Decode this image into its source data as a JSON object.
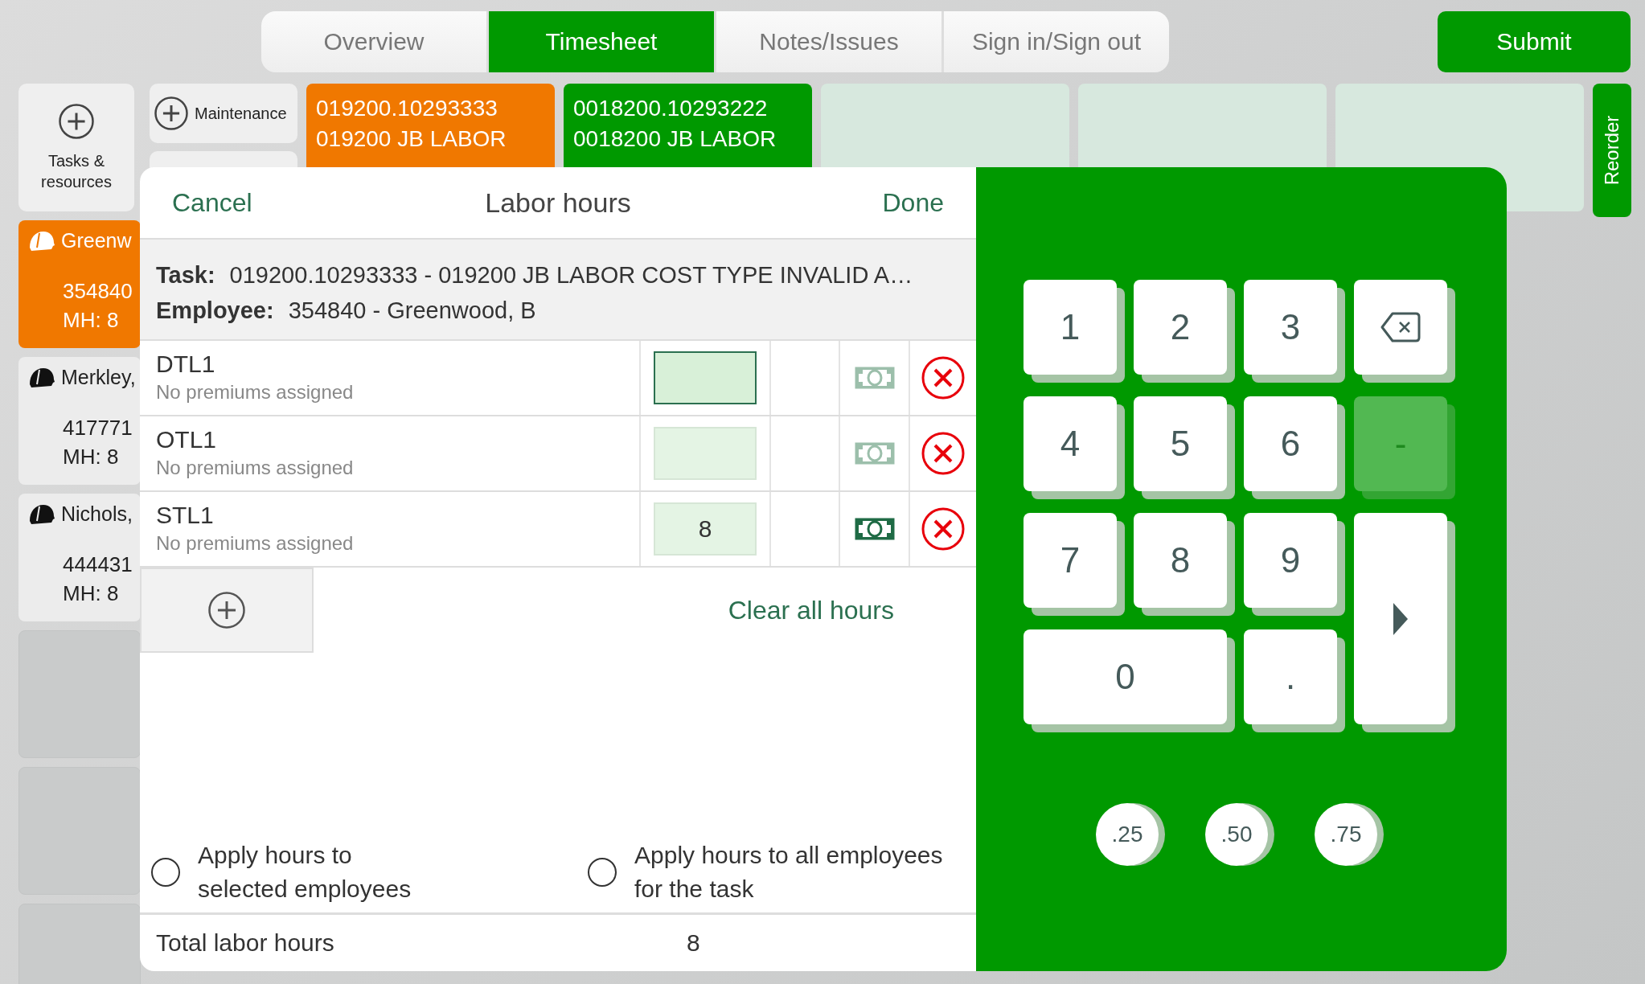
{
  "tabs": [
    {
      "label": "Overview",
      "selected": false
    },
    {
      "label": "Timesheet",
      "selected": true
    },
    {
      "label": "Notes/Issues",
      "selected": false
    },
    {
      "label": "Sign in/Sign out",
      "selected": false
    }
  ],
  "submit_button": "Submit",
  "add_tiles": [
    {
      "kind": "large",
      "label": "Tasks & resources"
    },
    {
      "kind": "inline",
      "label": "Maintenance"
    }
  ],
  "task_cards": [
    {
      "kind": "task",
      "color": "#f07800",
      "lines": [
        "019200.10293333",
        "019200 JB LABOR"
      ]
    },
    {
      "kind": "task",
      "color": "#009900",
      "lines": [
        "0018200.10293222",
        "0018200 JB LABOR"
      ]
    },
    {
      "kind": "empty"
    },
    {
      "kind": "empty"
    },
    {
      "kind": "empty"
    }
  ],
  "reorder_button": "Reorder",
  "employees": [
    {
      "name": "Greenw",
      "number": "354840",
      "hours": "MH: 8",
      "selected": true
    },
    {
      "name": "Merkley,",
      "number": "417771",
      "hours": "MH: 8",
      "selected": false
    },
    {
      "name": "Nichols,",
      "number": "444431",
      "hours": "MH: 8",
      "selected": false
    }
  ],
  "labor_dialog": {
    "cancel": "Cancel",
    "title": "Labor hours",
    "done": "Done",
    "task_label": "Task:",
    "task": "019200.10293333 - 019200 JB LABOR COST TYPE INVALID A…",
    "employee_label": "Employee:",
    "employee": "354840 - Greenwood, B",
    "rows": [
      {
        "code": "DTL1",
        "premiums": "No premiums assigned",
        "focused": true,
        "premium_active": false
      },
      {
        "code": "OTL1",
        "premiums": "No premiums assigned",
        "focused": false,
        "premium_active": false
      },
      {
        "code": "STL1",
        "premiums": "No premiums assigned",
        "hours": "8",
        "focused": false,
        "premium_active": true
      }
    ],
    "clear_all": "Clear all hours",
    "apply_options": [
      {
        "label": "Apply hours to selected employees",
        "selected": false
      },
      {
        "label": "Apply hours to all employees for the task",
        "selected": false
      }
    ],
    "total_label": "Total labor hours",
    "total": "8"
  },
  "keypad": {
    "keys": [
      {
        "kind": "digit",
        "label": "1"
      },
      {
        "kind": "digit",
        "label": "2"
      },
      {
        "kind": "digit",
        "label": "3"
      },
      {
        "kind": "backspace"
      },
      {
        "kind": "digit",
        "label": "4"
      },
      {
        "kind": "digit",
        "label": "5"
      },
      {
        "kind": "digit",
        "label": "6"
      },
      {
        "kind": "digit",
        "label": "-",
        "disabled": true
      },
      {
        "kind": "digit",
        "label": "7"
      },
      {
        "kind": "digit",
        "label": "8"
      },
      {
        "kind": "digit",
        "label": "9"
      },
      {
        "kind": "enter"
      },
      {
        "kind": "wide_digit",
        "label": "0"
      },
      {
        "kind": "digit",
        "label": "."
      }
    ],
    "quick": [
      ".25",
      ".50",
      ".75"
    ]
  }
}
